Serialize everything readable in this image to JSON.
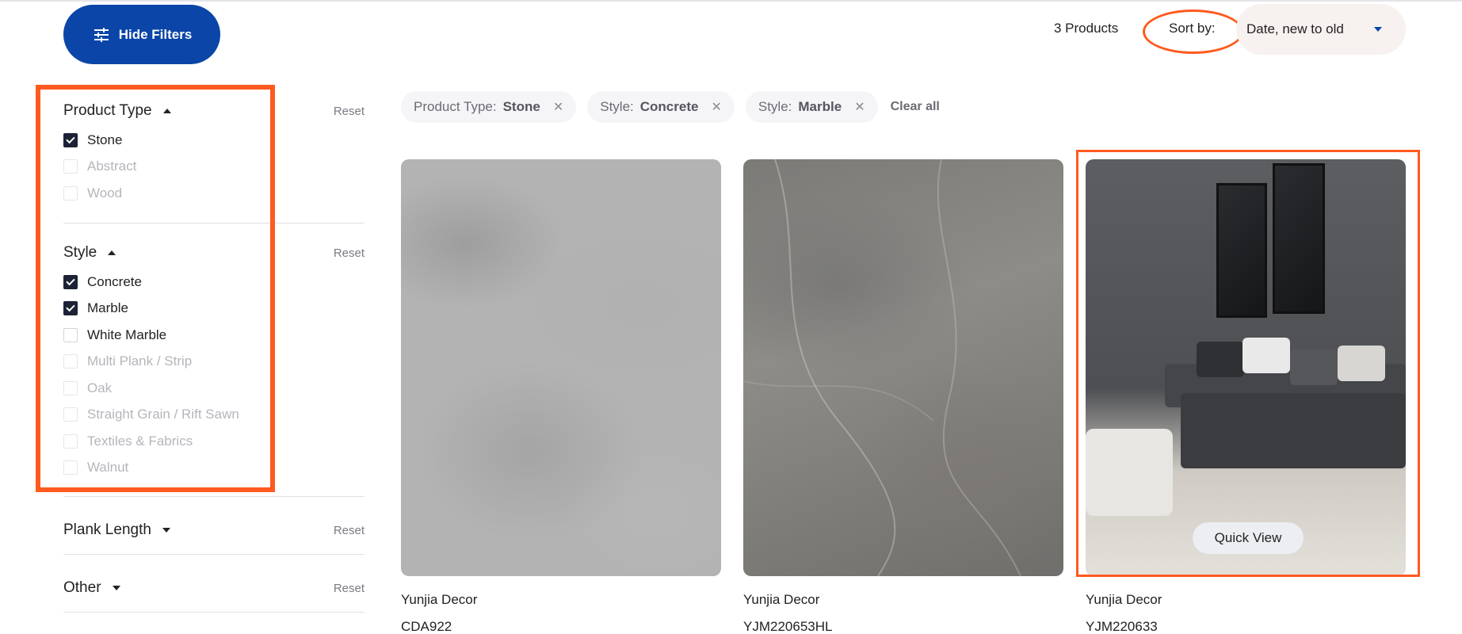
{
  "header": {
    "hide_filters_label": "Hide Filters",
    "product_count": "3 Products",
    "sort_label": "Sort by:",
    "sort_value": "Date, new to old"
  },
  "colors": {
    "primary": "#0b45a8",
    "annotation": "#ff5a1f"
  },
  "filters": {
    "product_type": {
      "title": "Product Type",
      "reset": "Reset",
      "options": [
        {
          "label": "Stone",
          "checked": true
        },
        {
          "label": "Abstract",
          "checked": false
        },
        {
          "label": "Wood",
          "checked": false
        }
      ]
    },
    "style": {
      "title": "Style",
      "reset": "Reset",
      "options": [
        {
          "label": "Concrete",
          "checked": true
        },
        {
          "label": "Marble",
          "checked": true
        },
        {
          "label": "White Marble",
          "checked": false
        },
        {
          "label": "Multi Plank / Strip",
          "checked": false
        },
        {
          "label": "Oak",
          "checked": false
        },
        {
          "label": "Straight Grain / Rift Sawn",
          "checked": false
        },
        {
          "label": "Textiles & Fabrics",
          "checked": false
        },
        {
          "label": "Walnut",
          "checked": false
        }
      ]
    },
    "plank_length": {
      "title": "Plank Length",
      "reset": "Reset"
    },
    "other": {
      "title": "Other",
      "reset": "Reset"
    }
  },
  "active_filters": [
    {
      "key": "Product Type:",
      "value": "Stone"
    },
    {
      "key": "Style:",
      "value": "Concrete"
    },
    {
      "key": "Style:",
      "value": "Marble"
    }
  ],
  "clear_all": "Clear all",
  "products": [
    {
      "brand": "Yunjia Decor",
      "code": "CDA922"
    },
    {
      "brand": "Yunjia Decor",
      "code": "YJM220653HL"
    },
    {
      "brand": "Yunjia Decor",
      "code": "YJM220633",
      "quick_view": "Quick View"
    }
  ]
}
